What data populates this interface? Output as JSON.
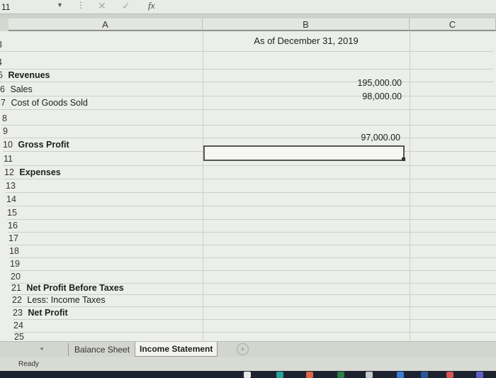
{
  "formula_bar": {
    "name_box": "11",
    "fx": "fx"
  },
  "columns": [
    {
      "label": "A"
    },
    {
      "label": "B"
    },
    {
      "label": "C"
    }
  ],
  "rows": [
    {
      "num": "3",
      "label": "",
      "bold": false
    },
    {
      "num": "4",
      "label": "",
      "bold": false
    },
    {
      "num": "5",
      "label": "Revenues",
      "bold": true
    },
    {
      "num": "6",
      "label": "Sales",
      "bold": false
    },
    {
      "num": "7",
      "label": "Cost of Goods Sold",
      "bold": false
    },
    {
      "num": "8",
      "label": "",
      "bold": false
    },
    {
      "num": "9",
      "label": "",
      "bold": false
    },
    {
      "num": "10",
      "label": "Gross Profit",
      "bold": true
    },
    {
      "num": "11",
      "label": "",
      "bold": false
    },
    {
      "num": "12",
      "label": "Expenses",
      "bold": true
    },
    {
      "num": "13",
      "label": "",
      "bold": false
    },
    {
      "num": "14",
      "label": "",
      "bold": false
    },
    {
      "num": "15",
      "label": "",
      "bold": false
    },
    {
      "num": "16",
      "label": "",
      "bold": false
    },
    {
      "num": "17",
      "label": "",
      "bold": false
    },
    {
      "num": "18",
      "label": "",
      "bold": false
    },
    {
      "num": "19",
      "label": "",
      "bold": false
    },
    {
      "num": "20",
      "label": "",
      "bold": false
    },
    {
      "num": "21",
      "label": "Net Profit Before Taxes",
      "bold": true
    },
    {
      "num": "22",
      "label": "Less: Income Taxes",
      "bold": false
    },
    {
      "num": "23",
      "label": "Net Profit",
      "bold": true
    },
    {
      "num": "24",
      "label": "",
      "bold": false
    },
    {
      "num": "25",
      "label": "",
      "bold": false
    }
  ],
  "cells": {
    "b_header": "As of December 31, 2019",
    "sales_value": "195,000.00",
    "cogs_value": "98,000.00",
    "gross_profit_value": "97,000.00"
  },
  "sheet_tabs": {
    "balance_sheet": "Balance Sheet",
    "income_statement": "Income Statement",
    "add": "+"
  },
  "status": {
    "ready": "Ready"
  },
  "colors": {
    "taskbar": "#1d2230",
    "selected_tab": "#f2f3ef"
  }
}
